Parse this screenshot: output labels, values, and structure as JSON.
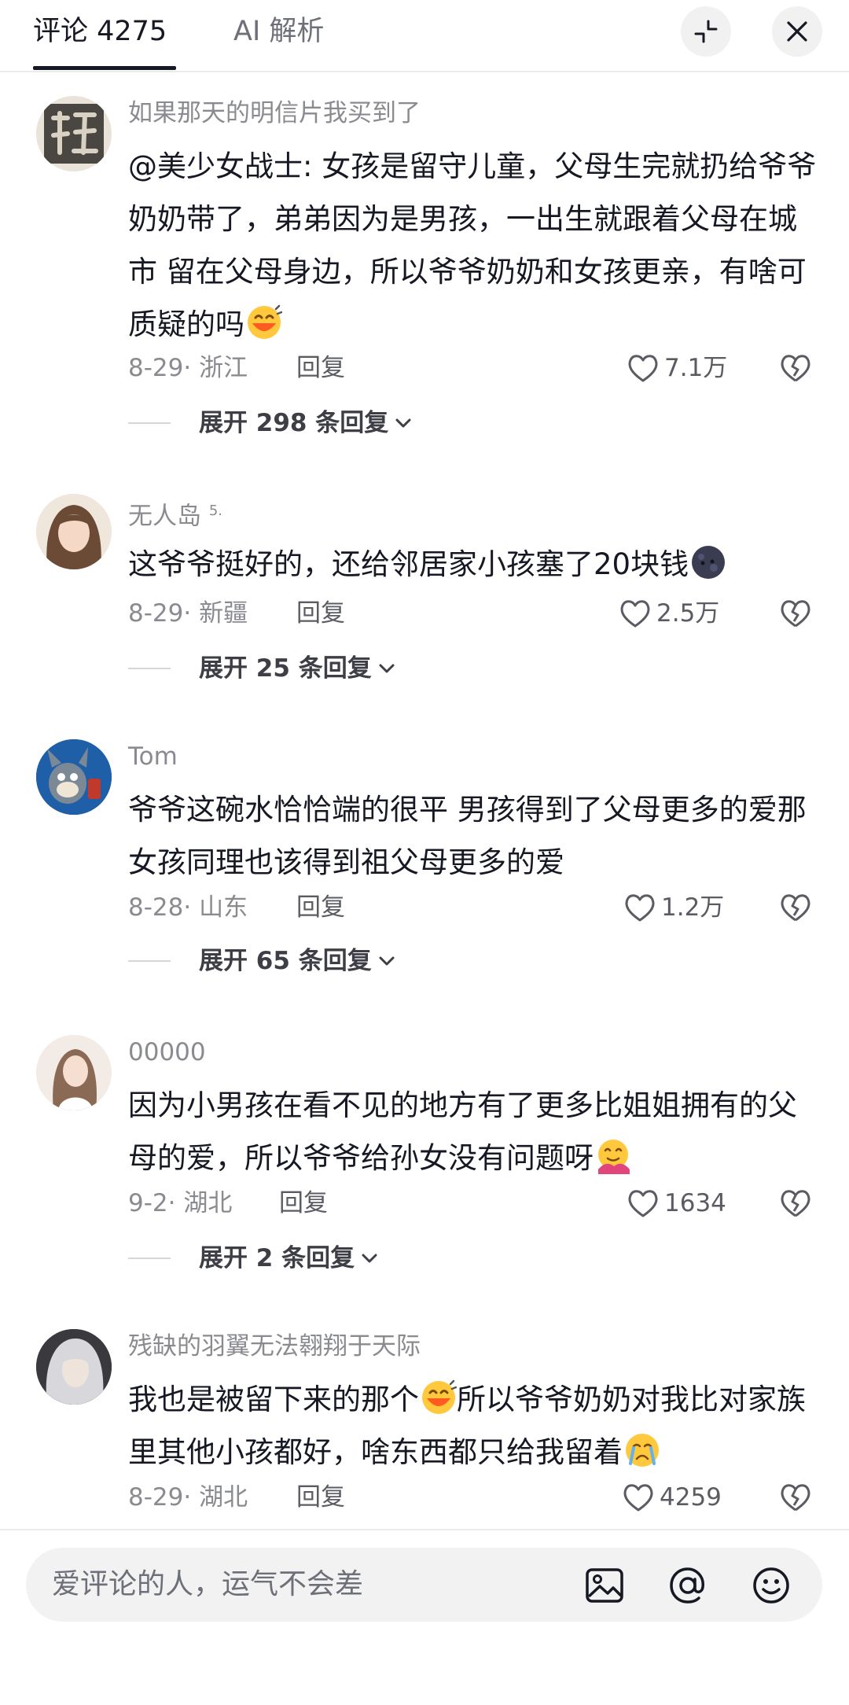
{
  "header": {
    "tab_comments": "评论 4275",
    "tab_ai": "AI 解析",
    "icons": [
      "collapse-icon",
      "close-icon"
    ]
  },
  "comments": [
    {
      "username": "如果那天的明信片我买到了",
      "text": "@美少女战士: 女孩是留守儿童，父母生完就扔给爷爷奶奶带了，弟弟因为是男孩，一出生就跟着父母在城市 留在父母身边，所以爷爷奶奶和女孩更亲，有啥可质疑的吗",
      "emoji": "laughing-tears-emoji",
      "date_location": "8-29· 浙江",
      "reply_label": "回复",
      "likes": "7.1万",
      "expand_label": "展开 298 条回复"
    },
    {
      "username": "无人岛",
      "username_sup": "5.",
      "text": "这爷爷挺好的，还给邻居家小孩塞了20块钱",
      "emoji": "dark-moon-emoji",
      "date_location": "8-29· 新疆",
      "reply_label": "回复",
      "likes": "2.5万",
      "expand_label": "展开 25 条回复"
    },
    {
      "username": "Tom",
      "text": "爷爷这碗水恰恰端的很平 男孩得到了父母更多的爱那女孩同理也该得到祖父母更多的爱",
      "date_location": "8-28· 山东",
      "reply_label": "回复",
      "likes": "1.2万",
      "expand_label": "展开 65 条回复"
    },
    {
      "username": "00000",
      "text": "因为小男孩在看不见的地方有了更多比姐姐拥有的父母的爱，所以爷爷给孙女没有问题呀",
      "emoji": "hugging-emoji",
      "date_location": "9-2· 湖北",
      "reply_label": "回复",
      "likes": "1634",
      "expand_label": "展开 2 条回复"
    },
    {
      "username": "残缺的羽翼无法翱翔于天际",
      "text_part1": "我也是被留下来的那个",
      "text_part2": "所以爷爷奶奶对我比对家族里其他小孩都好，啥东西都只给我留着",
      "emoji": "laughing-tears-emoji",
      "emoji2": "crying-emoji",
      "date_location": "8-29· 湖北",
      "reply_label": "回复",
      "likes": "4259"
    }
  ],
  "input": {
    "placeholder": "爱评论的人，运气不会差",
    "icons": [
      "image-icon",
      "at-icon",
      "emoji-icon"
    ]
  },
  "colors": {
    "text_primary": "#161823",
    "text_secondary": "#8a8b91",
    "emoji_yellow": "#ffc83d",
    "emoji_orange": "#ff5a1f"
  }
}
